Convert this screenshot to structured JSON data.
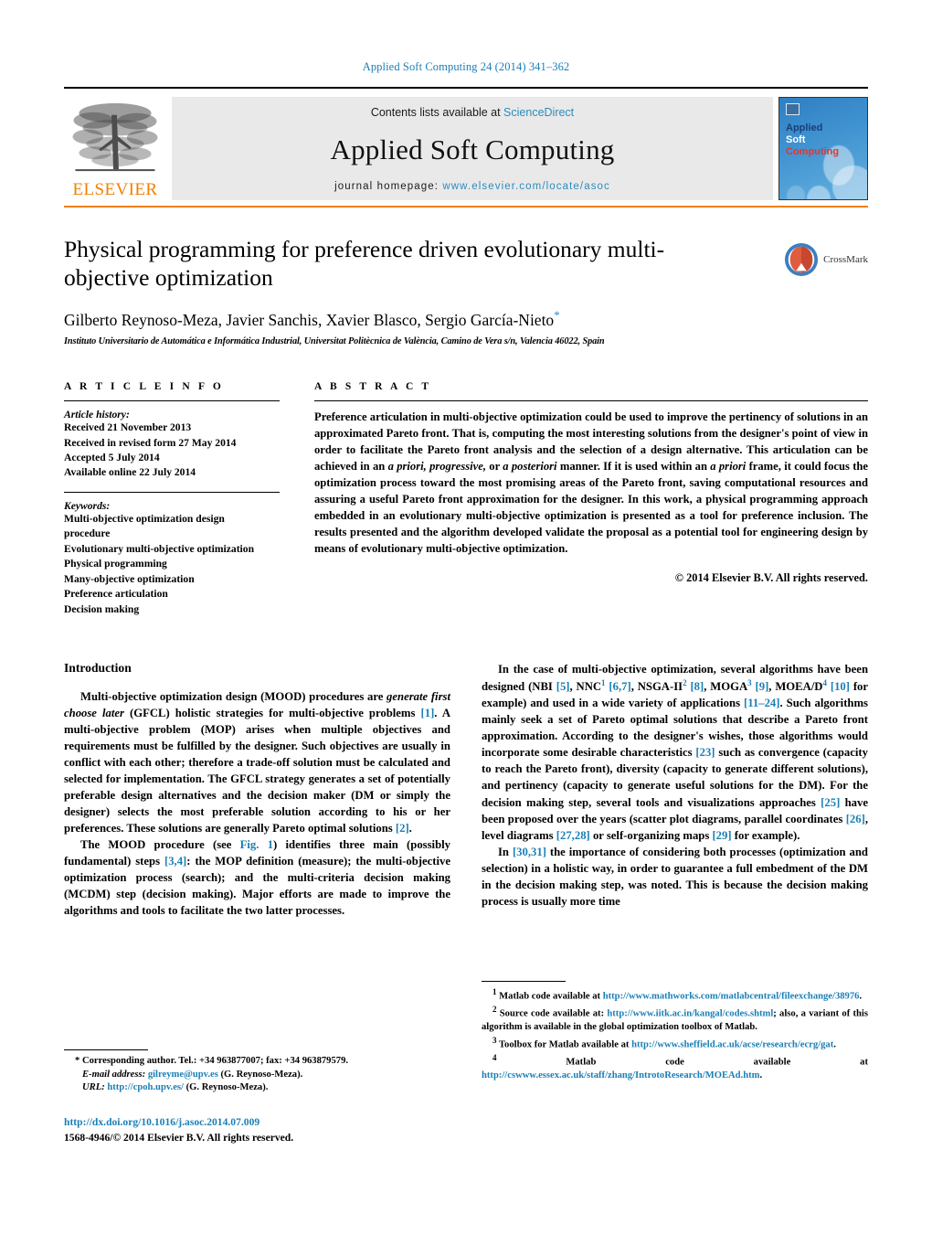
{
  "running_head": "Applied Soft Computing 24 (2014) 341–362",
  "masthead": {
    "publisher": "ELSEVIER",
    "contents_prefix": "Contents lists available at ",
    "contents_link": "ScienceDirect",
    "journal_title": "Applied Soft Computing",
    "homepage_prefix": "journal homepage: ",
    "homepage_url": "www.elsevier.com/locate/asoc",
    "cover": {
      "line1": "Applied",
      "line2": "Soft",
      "line3": "Computing"
    }
  },
  "article": {
    "title": "Physical programming for preference driven evolutionary multi-objective optimization",
    "authors": "Gilberto Reynoso-Meza, Javier Sanchis, Xavier Blasco, Sergio García-Nieto",
    "corresponding_marker": "*",
    "affiliation": "Instituto Universitario de Automática e Informática Industrial, Universitat Politècnica de València, Camino de Vera s/n, Valencia 46022, Spain",
    "crossmark_label": "CrossMark"
  },
  "article_info": {
    "heading": "A R T I C L E    I N F O",
    "history_label": "Article history:",
    "history": [
      "Received 21 November 2013",
      "Received in revised form 27 May 2014",
      "Accepted 5 July 2014",
      "Available online 22 July 2014"
    ],
    "keywords_label": "Keywords:",
    "keywords": [
      "Multi-objective optimization design",
      "procedure",
      "Evolutionary multi-objective optimization",
      "Physical programming",
      "Many-objective optimization",
      "Preference articulation",
      "Decision making"
    ]
  },
  "abstract": {
    "heading": "A B S T R A C T",
    "text_part1": "Preference articulation in multi-objective optimization could be used to improve the pertinency of solutions in an approximated Pareto front. That is, computing the most interesting solutions from the designer's point of view in order to facilitate the Pareto front analysis and the selection of a design alternative. This articulation can be achieved in an ",
    "em1": "a priori, progressive,",
    "text_part2": " or ",
    "em2": "a posteriori",
    "text_part3": " manner. If it is used within an ",
    "em3": "a priori",
    "text_part4": " frame, it could focus the optimization process toward the most promising areas of the Pareto front, saving computational resources and assuring a useful Pareto front approximation for the designer. In this work, a physical programming approach embedded in an evolutionary multi-objective optimization is presented as a tool for preference inclusion. The results presented and the algorithm developed validate the proposal as a potential tool for engineering design by means of evolutionary multi-objective optimization.",
    "copyright": "© 2014 Elsevier B.V. All rights reserved."
  },
  "introduction": {
    "heading": "Introduction",
    "left_p1_a": "Multi-objective optimization design (MOOD) procedures are ",
    "left_p1_em": "generate first choose later",
    "left_p1_b": " (GFCL) holistic strategies for multi-objective problems ",
    "left_p1_ref1": "[1]",
    "left_p1_c": ". A multi-objective problem (MOP) arises when multiple objectives and requirements must be fulfilled by the designer. Such objectives are usually in conflict with each other; therefore a trade-off solution must be calculated and selected for implementation. The GFCL strategy generates a set of potentially preferable design alternatives and the decision maker (DM or simply the designer) selects the most preferable solution according to his or her preferences. These solutions are generally Pareto optimal solutions ",
    "left_p1_ref2": "[2]",
    "left_p1_d": ".",
    "left_p2_a": "The MOOD procedure (see ",
    "left_p2_fig": "Fig. 1",
    "left_p2_b": ") identifies three main (possibly fundamental) steps ",
    "left_p2_ref": "[3,4]",
    "left_p2_c": ": the MOP definition (measure); the multi-objective optimization process (search); and the multi-criteria decision making (MCDM) step (decision making). Major efforts are made to improve the algorithms and tools to facilitate the two latter processes.",
    "right_p1_a": "In the case of multi-objective optimization, several algorithms have been designed (NBI ",
    "right_p1_r1": "[5]",
    "right_p1_b": ", NNC",
    "right_p1_sup1": "1",
    "right_p1_c": " ",
    "right_p1_r2": "[6,7]",
    "right_p1_d": ", NSGA-II",
    "right_p1_sup2": "2",
    "right_p1_e": " ",
    "right_p1_r3": "[8]",
    "right_p1_f": ", MOGA",
    "right_p1_sup3": "3",
    "right_p1_g": " ",
    "right_p1_r4": "[9]",
    "right_p1_h": ", MOEA/D",
    "right_p1_sup4": "4",
    "right_p1_i": " ",
    "right_p1_r5": "[10]",
    "right_p1_j": " for example) and used in a wide variety of applications ",
    "right_p1_r6": "[11–24]",
    "right_p1_k": ". Such algorithms mainly seek a set of Pareto optimal solutions that describe a Pareto front approximation. According to the designer's wishes, those algorithms would incorporate some desirable characteristics ",
    "right_p1_r7": "[23]",
    "right_p1_l": " such as convergence (capacity to reach the Pareto front), diversity (capacity to generate different solutions), and pertinency (capacity to generate useful solutions for the DM). For the decision making step, several tools and visualizations approaches ",
    "right_p1_r8": "[25]",
    "right_p1_m": " have been proposed over the years (scatter plot diagrams, parallel coordinates ",
    "right_p1_r9": "[26]",
    "right_p1_n": ", level diagrams ",
    "right_p1_r10": "[27,28]",
    "right_p1_o": " or self-organizing maps ",
    "right_p1_r11": "[29]",
    "right_p1_p": " for example).",
    "right_p2_a": "In ",
    "right_p2_r1": "[30,31]",
    "right_p2_b": " the importance of considering both processes (optimization and selection) in a holistic way, in order to guarantee a full embedment of the DM in the decision making step, was noted. This is because the decision making process is usually more time"
  },
  "footnotes_right": [
    {
      "marker": "1",
      "text_a": "Matlab code available at ",
      "link": "http://www.mathworks.com/matlabcentral/fileexchange/38976",
      "text_b": "."
    },
    {
      "marker": "2",
      "text_a": "Source code available at: ",
      "link": "http://www.iitk.ac.in/kangal/codes.shtml",
      "text_b": "; also, a variant of this algorithm is available in the global optimization toolbox of Matlab."
    },
    {
      "marker": "3",
      "text_a": "Toolbox for Matlab available at ",
      "link": "http://www.sheffield.ac.uk/acse/research/ecrg/gat",
      "text_b": "."
    },
    {
      "marker": "4",
      "text_a": "Matlab code available at ",
      "link": "http://cswww.essex.ac.uk/staff/zhang/IntrotoResearch/MOEAd.htm",
      "text_b": "."
    }
  ],
  "footer_left": {
    "corr_marker": "*",
    "corr_text": "Corresponding author. Tel.: +34 963877007; fax: +34 963879579.",
    "email_label": "E-mail address:",
    "email": "gilreyme@upv.es",
    "email_suffix": "(G. Reynoso-Meza).",
    "url_label": "URL:",
    "url": "http://cpoh.upv.es/",
    "url_suffix": "(G. Reynoso-Meza).",
    "doi": "http://dx.doi.org/10.1016/j.asoc.2014.07.009",
    "issn_line": "1568-4946/© 2014 Elsevier B.V. All rights reserved."
  },
  "colors": {
    "link_blue": "#1a7fb5",
    "elsevier_orange": "#F08000",
    "band_gray": "#e9e9e9"
  }
}
